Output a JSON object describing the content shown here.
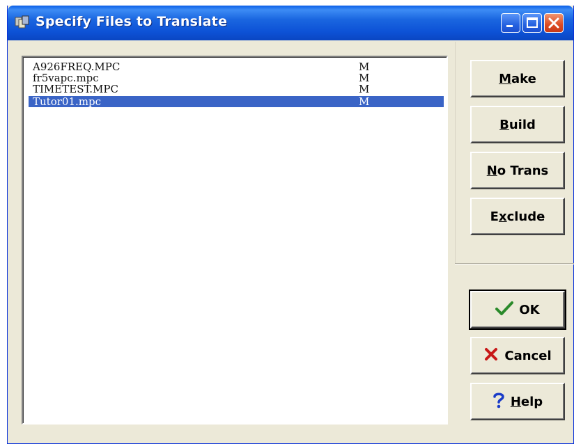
{
  "window": {
    "title": "Specify Files to Translate"
  },
  "files": [
    {
      "name": "A926FREQ.MPC",
      "flag": "M",
      "selected": false
    },
    {
      "name": "fr5vapc.mpc",
      "flag": "M",
      "selected": false
    },
    {
      "name": "TIMETEST.MPC",
      "flag": "M",
      "selected": false
    },
    {
      "name": "Tutor01.mpc",
      "flag": "M",
      "selected": true
    }
  ],
  "buttons": {
    "make": {
      "pre": "",
      "mn": "M",
      "post": "ake"
    },
    "build": {
      "pre": "",
      "mn": "B",
      "post": "uild"
    },
    "notrans": {
      "pre": "",
      "mn": "N",
      "post": "o Trans"
    },
    "exclude": {
      "pre": "E",
      "mn": "x",
      "post": "clude"
    },
    "ok": {
      "label": "OK",
      "icon": "checkmark-icon"
    },
    "cancel": {
      "label": "Cancel",
      "icon": "x-icon"
    },
    "help": {
      "pre": "",
      "mn": "H",
      "post": "elp",
      "icon": "question-icon"
    }
  },
  "colors": {
    "selection": "#3a64c6",
    "titlebar": "#0d52d6",
    "face": "#ece9d8",
    "ok_icon": "#2a8a2a",
    "cancel_icon": "#c81818",
    "help_icon": "#1a3cc8"
  }
}
